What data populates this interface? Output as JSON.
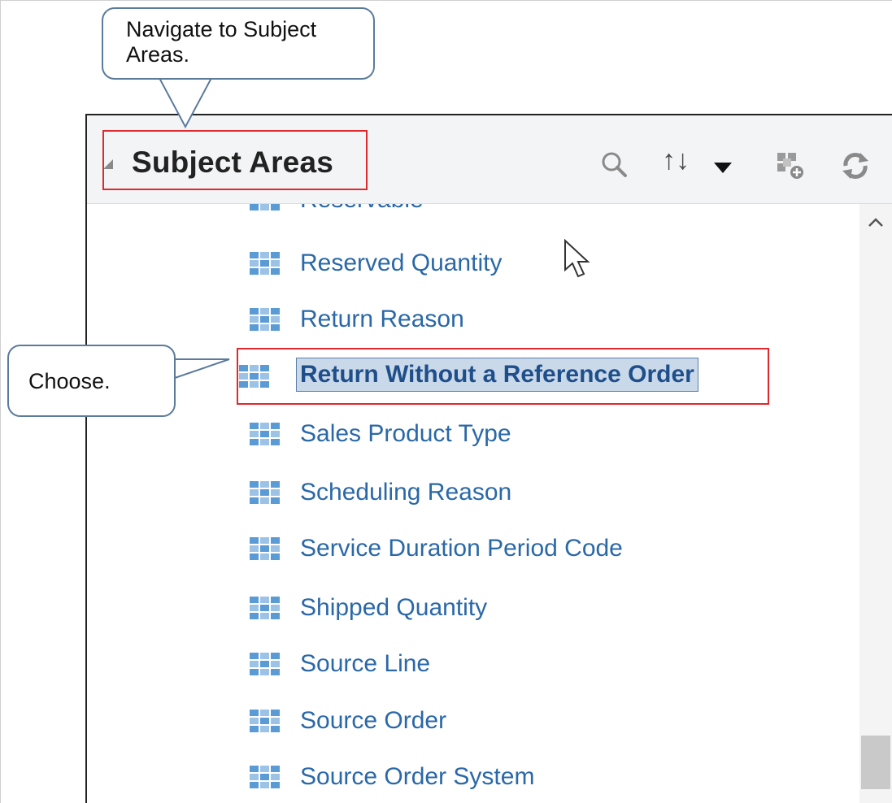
{
  "panel": {
    "title": "Subject Areas",
    "toolbar": {
      "search_icon": "search-icon",
      "sort_label": "↑↓",
      "sort_icon": "sort-icon",
      "add_icon": "add-subject-area-icon",
      "refresh_icon": "refresh-icon"
    }
  },
  "list": {
    "items": [
      {
        "label": "Reservable"
      },
      {
        "label": "Reserved Quantity"
      },
      {
        "label": "Return Reason"
      },
      {
        "label": "Return Without a Reference Order",
        "selected": true
      },
      {
        "label": "Sales Product Type"
      },
      {
        "label": "Scheduling Reason"
      },
      {
        "label": "Service Duration Period Code"
      },
      {
        "label": "Shipped Quantity"
      },
      {
        "label": "Source Line"
      },
      {
        "label": "Source Order"
      },
      {
        "label": "Source Order System"
      }
    ]
  },
  "callouts": {
    "navigate": "Navigate  to Subject Areas.",
    "choose": "Choose."
  },
  "colors": {
    "link": "#2a68a8",
    "highlight_box": "#e0282e",
    "selection_bg": "#c9d9ea",
    "callout_border": "#5b7b9c"
  }
}
